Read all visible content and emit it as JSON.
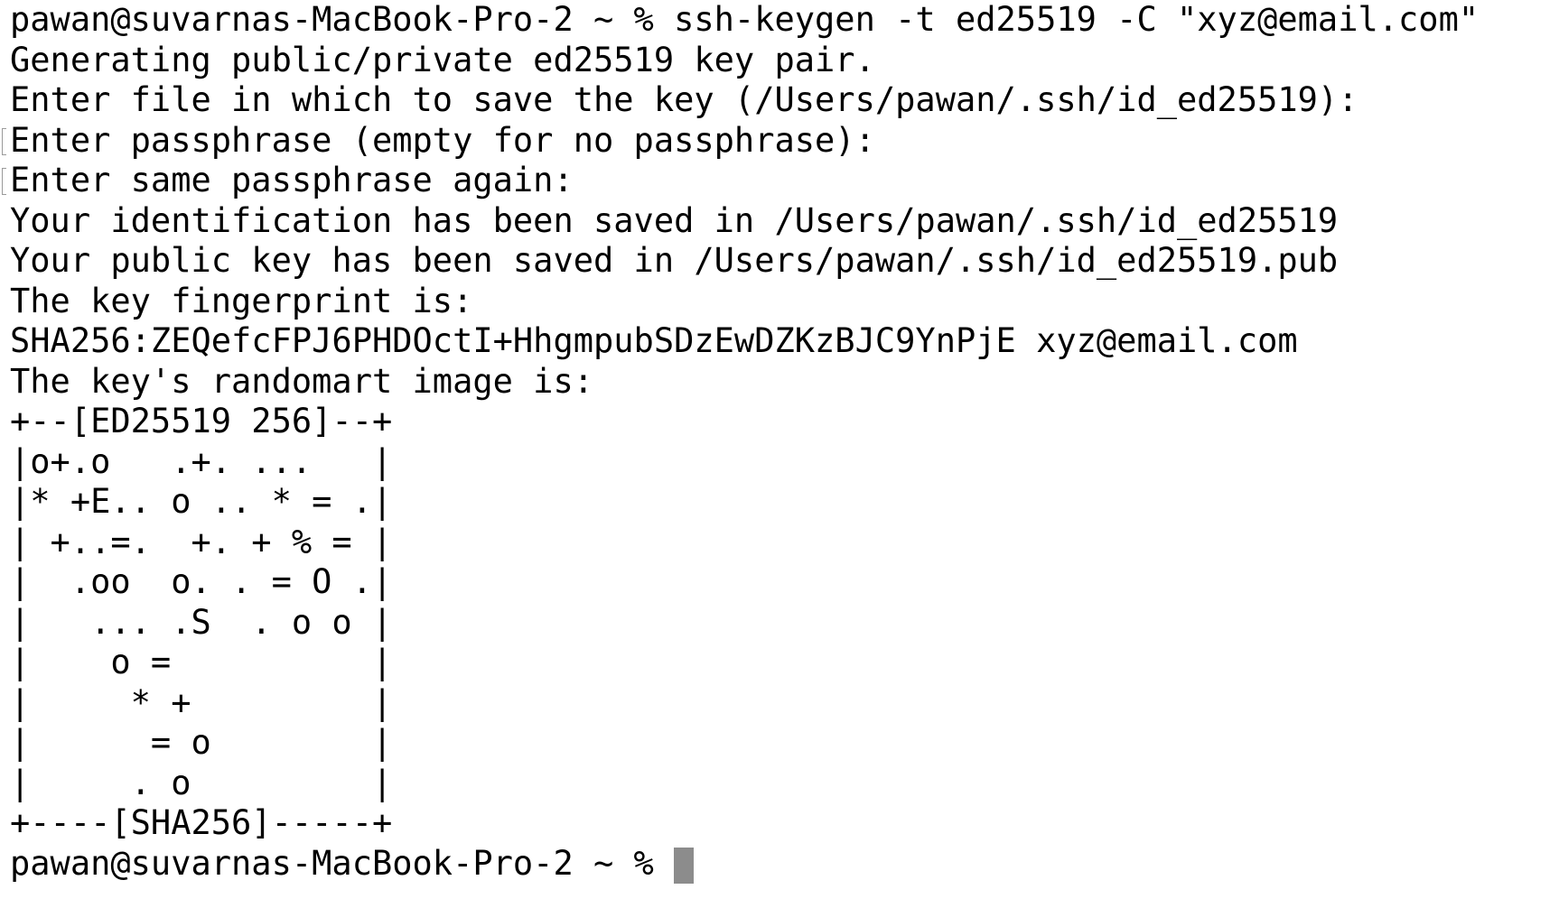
{
  "terminal": {
    "lines": [
      "pawan@suvarnas-MacBook-Pro-2 ~ % ssh-keygen -t ed25519 -C \"xyz@email.com\"",
      "Generating public/private ed25519 key pair.",
      "Enter file in which to save the key (/Users/pawan/.ssh/id_ed25519):",
      "Enter passphrase (empty for no passphrase):",
      "Enter same passphrase again:",
      "Your identification has been saved in /Users/pawan/.ssh/id_ed25519",
      "Your public key has been saved in /Users/pawan/.ssh/id_ed25519.pub",
      "The key fingerprint is:",
      "SHA256:ZEQefcFPJ6PHDOctI+HhgmpubSDzEwDZKzBJC9YnPjE xyz@email.com",
      "The key's randomart image is:",
      "+--[ED25519 256]--+",
      "|o+.o   .+. ...   |",
      "|* +E.. o .. * = .|",
      "| +..=.  +. + % = |",
      "|  .oo  o. . = O .|",
      "|   ... .S  . o o |",
      "|    o =          |",
      "|     * +         |",
      "|      = o        |",
      "|     . o         |",
      "+----[SHA256]-----+"
    ],
    "prompt": "pawan@suvarnas-MacBook-Pro-2 ~ % "
  }
}
